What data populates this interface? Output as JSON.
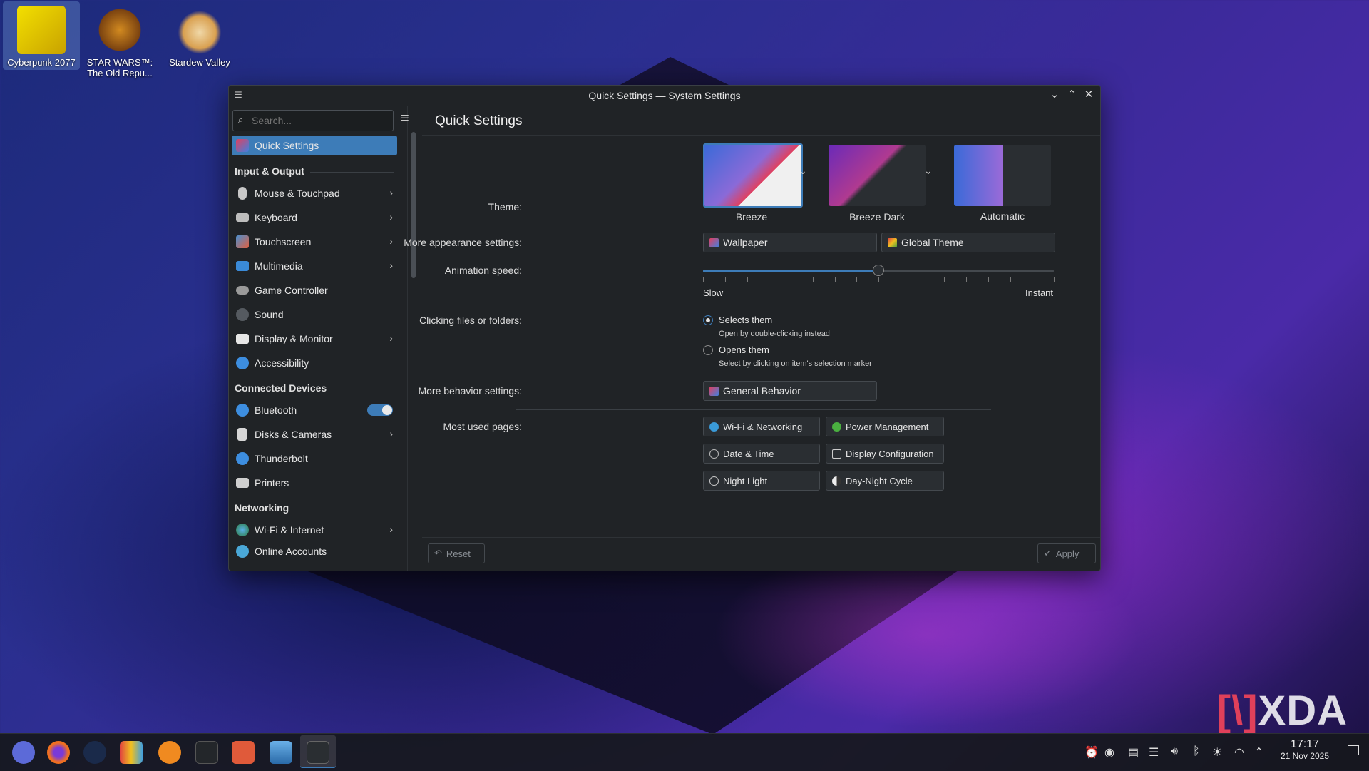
{
  "desktop": {
    "icons": [
      {
        "label": "Cyberpunk 2077"
      },
      {
        "label": "STAR WARS™: The Old Repu..."
      },
      {
        "label": "Stardew Valley"
      }
    ],
    "watermark": "XDA"
  },
  "window": {
    "title": "Quick Settings — System Settings",
    "search_placeholder": "Search...",
    "sidebar": {
      "active": "Quick Settings",
      "sections": {
        "input_output": "Input & Output",
        "connected_devices": "Connected Devices",
        "networking": "Networking"
      },
      "items": {
        "mouse": "Mouse & Touchpad",
        "keyboard": "Keyboard",
        "touchscreen": "Touchscreen",
        "multimedia": "Multimedia",
        "game_controller": "Game Controller",
        "sound": "Sound",
        "display": "Display & Monitor",
        "accessibility": "Accessibility",
        "bluetooth": "Bluetooth",
        "disks": "Disks & Cameras",
        "thunderbolt": "Thunderbolt",
        "printers": "Printers",
        "wifi": "Wi-Fi & Internet",
        "online_accounts": "Online Accounts"
      },
      "bluetooth_enabled": true
    },
    "main": {
      "heading": "Quick Settings",
      "theme_label": "Theme:",
      "themes": [
        "Breeze",
        "Breeze Dark",
        "Automatic"
      ],
      "more_appearance_label": "More appearance settings:",
      "wallpaper_button": "Wallpaper",
      "global_theme_button": "Global Theme",
      "animation_label": "Animation speed:",
      "animation_value": 0.5,
      "slow": "Slow",
      "instant": "Instant",
      "clicking_label": "Clicking files or folders:",
      "option1": "Selects them",
      "option1_hint": "Open by double-clicking instead",
      "option2": "Opens them",
      "option2_hint": "Select by clicking on item's selection marker",
      "selected_option": "Selects them",
      "more_behavior_label": "More behavior settings:",
      "general_behavior_button": "General Behavior",
      "most_used_label": "Most used pages:",
      "most_used": {
        "wifi": "Wi-Fi & Networking",
        "power": "Power Management",
        "date": "Date & Time",
        "display": "Display Configuration",
        "night": "Night Light",
        "daynight": "Day-Night Cycle"
      },
      "reset": "Reset",
      "apply": "Apply"
    }
  },
  "taskbar": {
    "time": "17:17",
    "date": "21 Nov 2025"
  },
  "colors": {
    "accent": "#3d7cb8",
    "window_bg": "#202326"
  }
}
